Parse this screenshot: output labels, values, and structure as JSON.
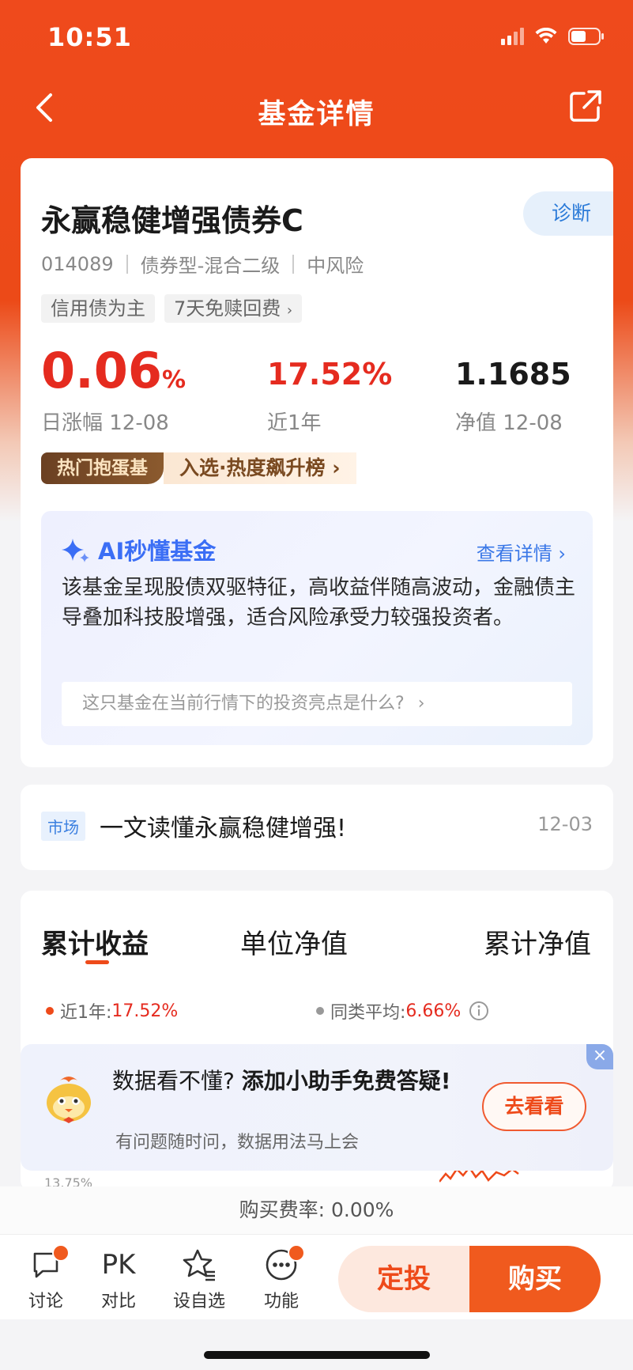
{
  "status": {
    "time": "10:51"
  },
  "nav": {
    "title": "基金详情"
  },
  "fund": {
    "name": "永赢稳健增强债券C",
    "diagnose_label": "诊断",
    "code": "014089",
    "type": "债券型-混合二级",
    "risk": "中风险",
    "tags": [
      "信用债为主",
      "7天免赎回费"
    ],
    "daily_change": "0.06",
    "daily_change_unit": "%",
    "daily_change_label": "日涨幅 12-08",
    "year_return": "17.52%",
    "year_return_label": "近1年",
    "nav_value": "1.1685",
    "nav_label": "净值 12-08",
    "rank_badge": "热门抱蛋基",
    "rank_text": "入选·热度飙升榜"
  },
  "ai": {
    "title": "AI秒懂基金",
    "more": "查看详情",
    "summary": "该基金呈现股债双驱特征，高收益伴随高波动，金融债主导叠加科技股增强，适合风险承受力较强投资者。",
    "question": "这只基金在当前行情下的投资亮点是什么?"
  },
  "news": {
    "tag": "市场",
    "title": "一文读懂永赢稳健增强!",
    "date": "12-03"
  },
  "chart": {
    "tabs": [
      "累计收益",
      "单位净值",
      "累计净值"
    ],
    "legend_self_label": "近1年:",
    "legend_self_value": "17.52%",
    "legend_avg_label": "同类平均:",
    "legend_avg_value": "6.66%",
    "axis_top": "13.75%"
  },
  "promo": {
    "title_a": "数据看不懂?",
    "title_b": "添加小助手免费答疑!",
    "subtitle": "有问题随时问，数据用法马上会",
    "button": "去看看"
  },
  "fee": {
    "text": "购买费率: 0.00%"
  },
  "bottom": {
    "discuss": "讨论",
    "pk_icon": "PK",
    "compare": "对比",
    "watch": "设自选",
    "func": "功能",
    "invest": "定投",
    "buy": "购买"
  },
  "colors": {
    "brand": "#ee4a1a",
    "up": "#e52b1f",
    "ai": "#3b6ef5"
  }
}
